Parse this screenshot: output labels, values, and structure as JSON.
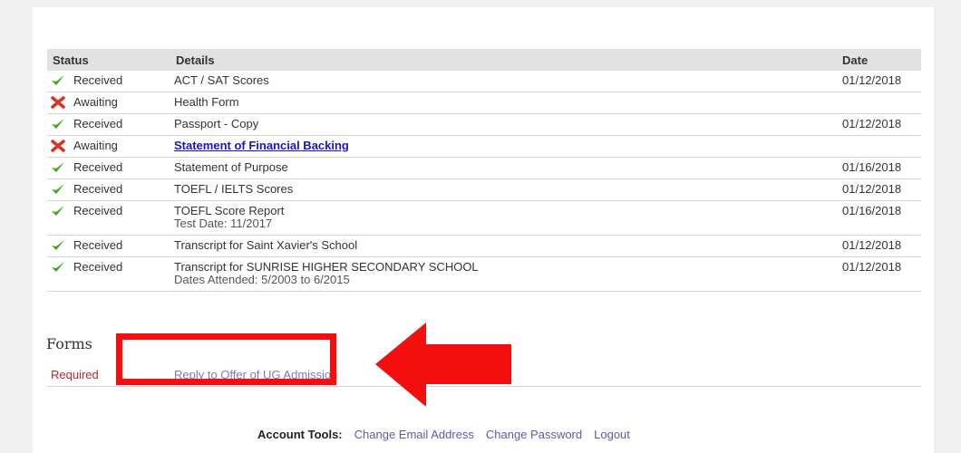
{
  "checklist": {
    "headers": {
      "status": "Status",
      "details": "Details",
      "date": "Date"
    },
    "rows": [
      {
        "icon": "check",
        "status": "Received",
        "details": "ACT / SAT Scores",
        "sub": "",
        "link": false,
        "date": "01/12/2018"
      },
      {
        "icon": "cross",
        "status": "Awaiting",
        "details": "Health Form",
        "sub": "",
        "link": false,
        "date": ""
      },
      {
        "icon": "check",
        "status": "Received",
        "details": "Passport - Copy",
        "sub": "",
        "link": false,
        "date": "01/12/2018"
      },
      {
        "icon": "cross",
        "status": "Awaiting",
        "details": "Statement of Financial Backing",
        "sub": "",
        "link": true,
        "date": ""
      },
      {
        "icon": "check",
        "status": "Received",
        "details": "Statement of Purpose",
        "sub": "",
        "link": false,
        "date": "01/16/2018"
      },
      {
        "icon": "check",
        "status": "Received",
        "details": "TOEFL / IELTS Scores",
        "sub": "",
        "link": false,
        "date": "01/12/2018"
      },
      {
        "icon": "check",
        "status": "Received",
        "details": "TOEFL Score Report",
        "sub": "Test Date: 11/2017",
        "link": false,
        "date": "01/16/2018"
      },
      {
        "icon": "check",
        "status": "Received",
        "details": "Transcript for Saint Xavier's School",
        "sub": "",
        "link": false,
        "date": "01/12/2018"
      },
      {
        "icon": "check",
        "status": "Received",
        "details": "Transcript for SUNRISE HIGHER SECONDARY SCHOOL",
        "sub": "Dates Attended: 5/2003 to 6/2015",
        "link": false,
        "date": "01/12/2018"
      }
    ]
  },
  "forms": {
    "title": "Forms",
    "required_label": "Required",
    "link_label": "Reply to Offer of UG Admission"
  },
  "account_tools": {
    "label": "Account Tools:",
    "change_email": "Change Email Address",
    "change_password": "Change Password",
    "logout": "Logout"
  },
  "colors": {
    "check": "#3aa516",
    "cross": "#e0301e",
    "annotation": "#f40e0e",
    "link": "#1a13c8",
    "required": "#c0262d"
  }
}
